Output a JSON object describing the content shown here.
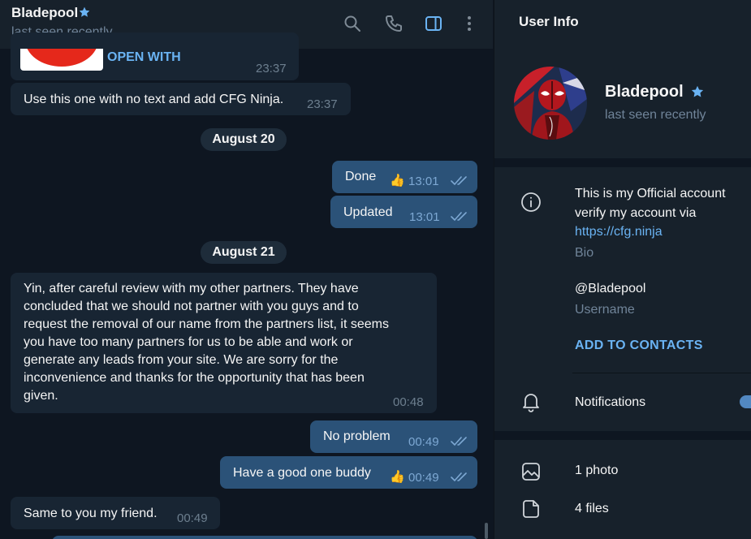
{
  "chat": {
    "header": {
      "name": "Bladepool",
      "status": "last seen recently"
    },
    "messages": [
      {
        "id": "m1",
        "dir": "in",
        "link_label": "OPEN WITH",
        "time": "23:37"
      },
      {
        "id": "m2",
        "dir": "in",
        "text": "Use this one with no text and add CFG Ninja.",
        "time": "23:37"
      },
      {
        "id": "d1",
        "type": "date",
        "text": "August 20"
      },
      {
        "id": "m3",
        "dir": "out",
        "text": "Done",
        "reaction": "👍",
        "time": "13:01"
      },
      {
        "id": "m4",
        "dir": "out",
        "text": "Updated",
        "time": "13:01"
      },
      {
        "id": "d2",
        "type": "date",
        "text": "August 21"
      },
      {
        "id": "m5",
        "dir": "in",
        "lines": [
          "Yin, after careful review with my other partners. They have",
          "concluded that we should not partner with you guys and to",
          "request the removal of our name from the partners list, it seems",
          "you have too many partners for us to be able and work or",
          "generate any leads from your site. We are sorry for the",
          "inconvenience and thanks for the opportunity that has been",
          "given."
        ],
        "time": "00:48"
      },
      {
        "id": "m6",
        "dir": "out",
        "text": "No problem",
        "time": "00:49"
      },
      {
        "id": "m7",
        "dir": "out",
        "text": "Have a good one buddy",
        "reaction": "👍",
        "time": "00:49"
      },
      {
        "id": "m8",
        "dir": "in",
        "text": "Same to you my friend.",
        "time": "00:49"
      }
    ]
  },
  "info": {
    "title": "User Info",
    "name": "Bladepool",
    "status": "last seen recently",
    "bio_lines": [
      "This is my Official account",
      "verify my account via"
    ],
    "bio_link": "https://cfg.ninja",
    "bio_label": "Bio",
    "username": "@Bladepool",
    "username_label": "Username",
    "add_contacts": "ADD TO CONTACTS",
    "notifications": "Notifications",
    "notifications_on": true,
    "photos": "1 photo",
    "files": "4 files"
  },
  "icons": {
    "verified": "star-icon",
    "search": "search-icon",
    "call": "phone-icon",
    "sidebar": "sidebar-toggle-icon",
    "more": "more-vertical-icon",
    "info": "info-icon",
    "bell": "bell-icon",
    "photo": "photo-icon",
    "file": "file-icon"
  },
  "colors": {
    "background": "#0e1621",
    "panel": "#17212b",
    "bubble_in": "#182533",
    "bubble_out": "#2b5278",
    "accent": "#6ab3f3",
    "secondary_text": "#708499"
  }
}
